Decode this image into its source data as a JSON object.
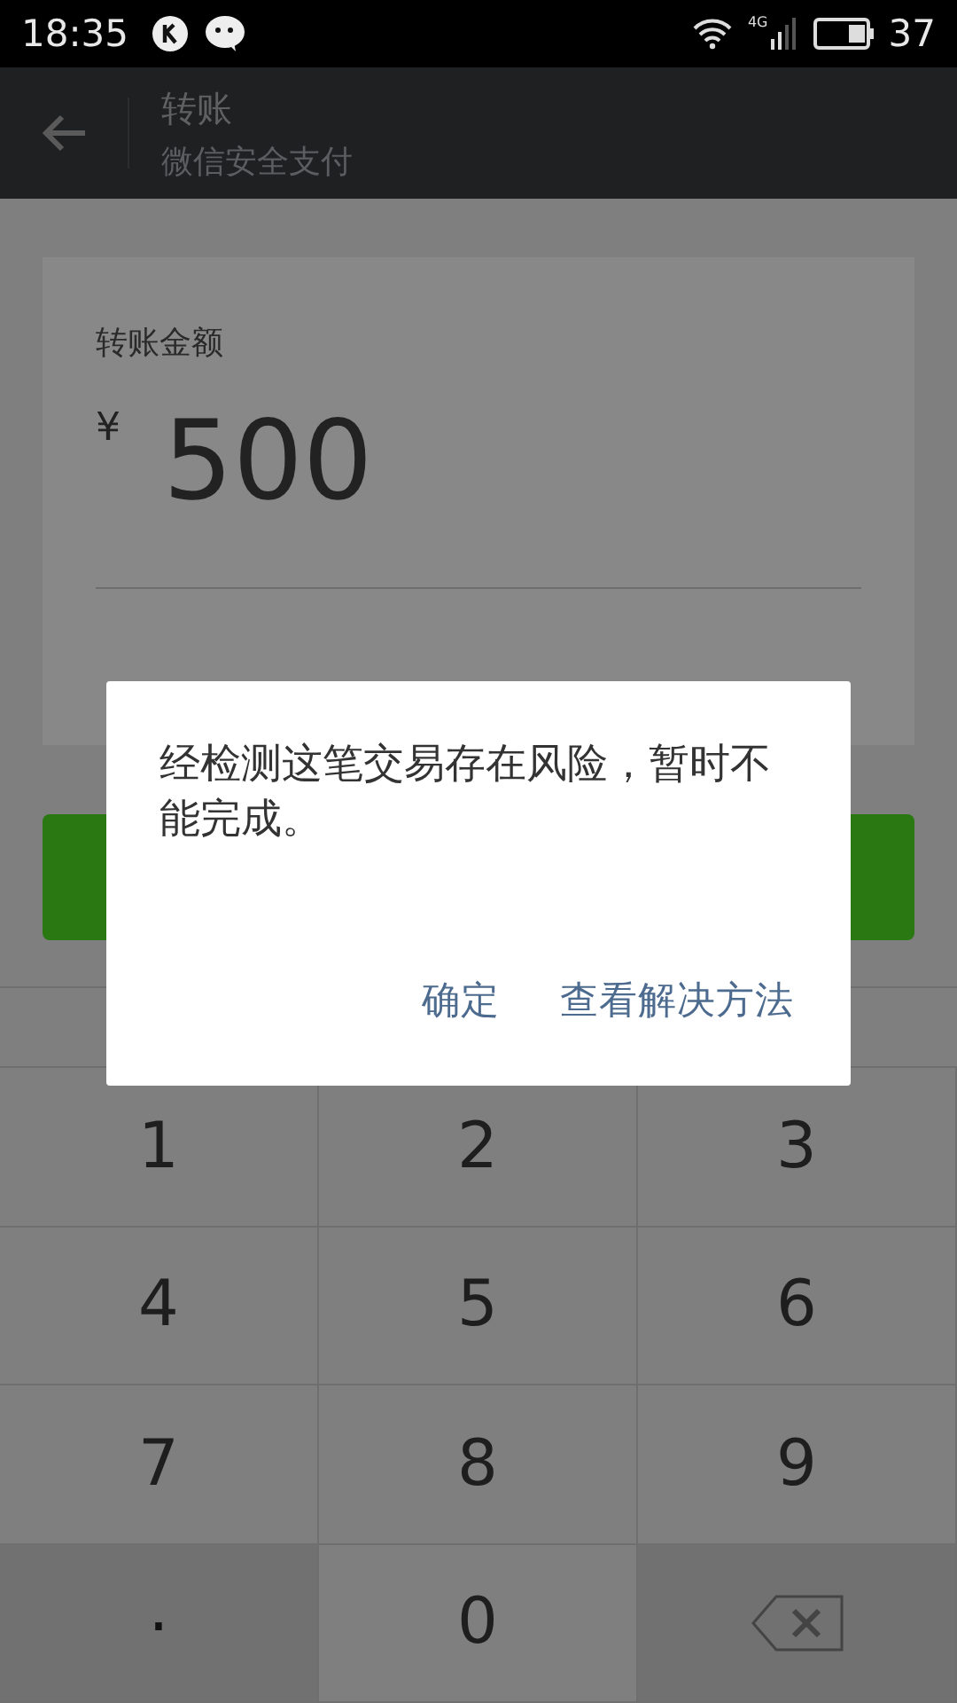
{
  "status_bar": {
    "time": "18:35",
    "network": "4G",
    "battery": "37"
  },
  "app_bar": {
    "title": "转账",
    "subtitle": "微信安全支付"
  },
  "amount_card": {
    "label": "转账金额",
    "currency": "¥",
    "amount": "500"
  },
  "keypad": [
    {
      "kind": "digit",
      "label": "1"
    },
    {
      "kind": "digit",
      "label": "2"
    },
    {
      "kind": "digit",
      "label": "3"
    },
    {
      "kind": "digit",
      "label": "4"
    },
    {
      "kind": "digit",
      "label": "5"
    },
    {
      "kind": "digit",
      "label": "6"
    },
    {
      "kind": "digit",
      "label": "7"
    },
    {
      "kind": "digit",
      "label": "8"
    },
    {
      "kind": "digit",
      "label": "9"
    },
    {
      "kind": "dot",
      "label": "."
    },
    {
      "kind": "digit",
      "label": "0"
    },
    {
      "kind": "backspace"
    }
  ],
  "dialog": {
    "message": "经检测这笔交易存在风险，暂时不能完成。",
    "buttons": [
      "确定",
      "查看解决方法"
    ]
  }
}
